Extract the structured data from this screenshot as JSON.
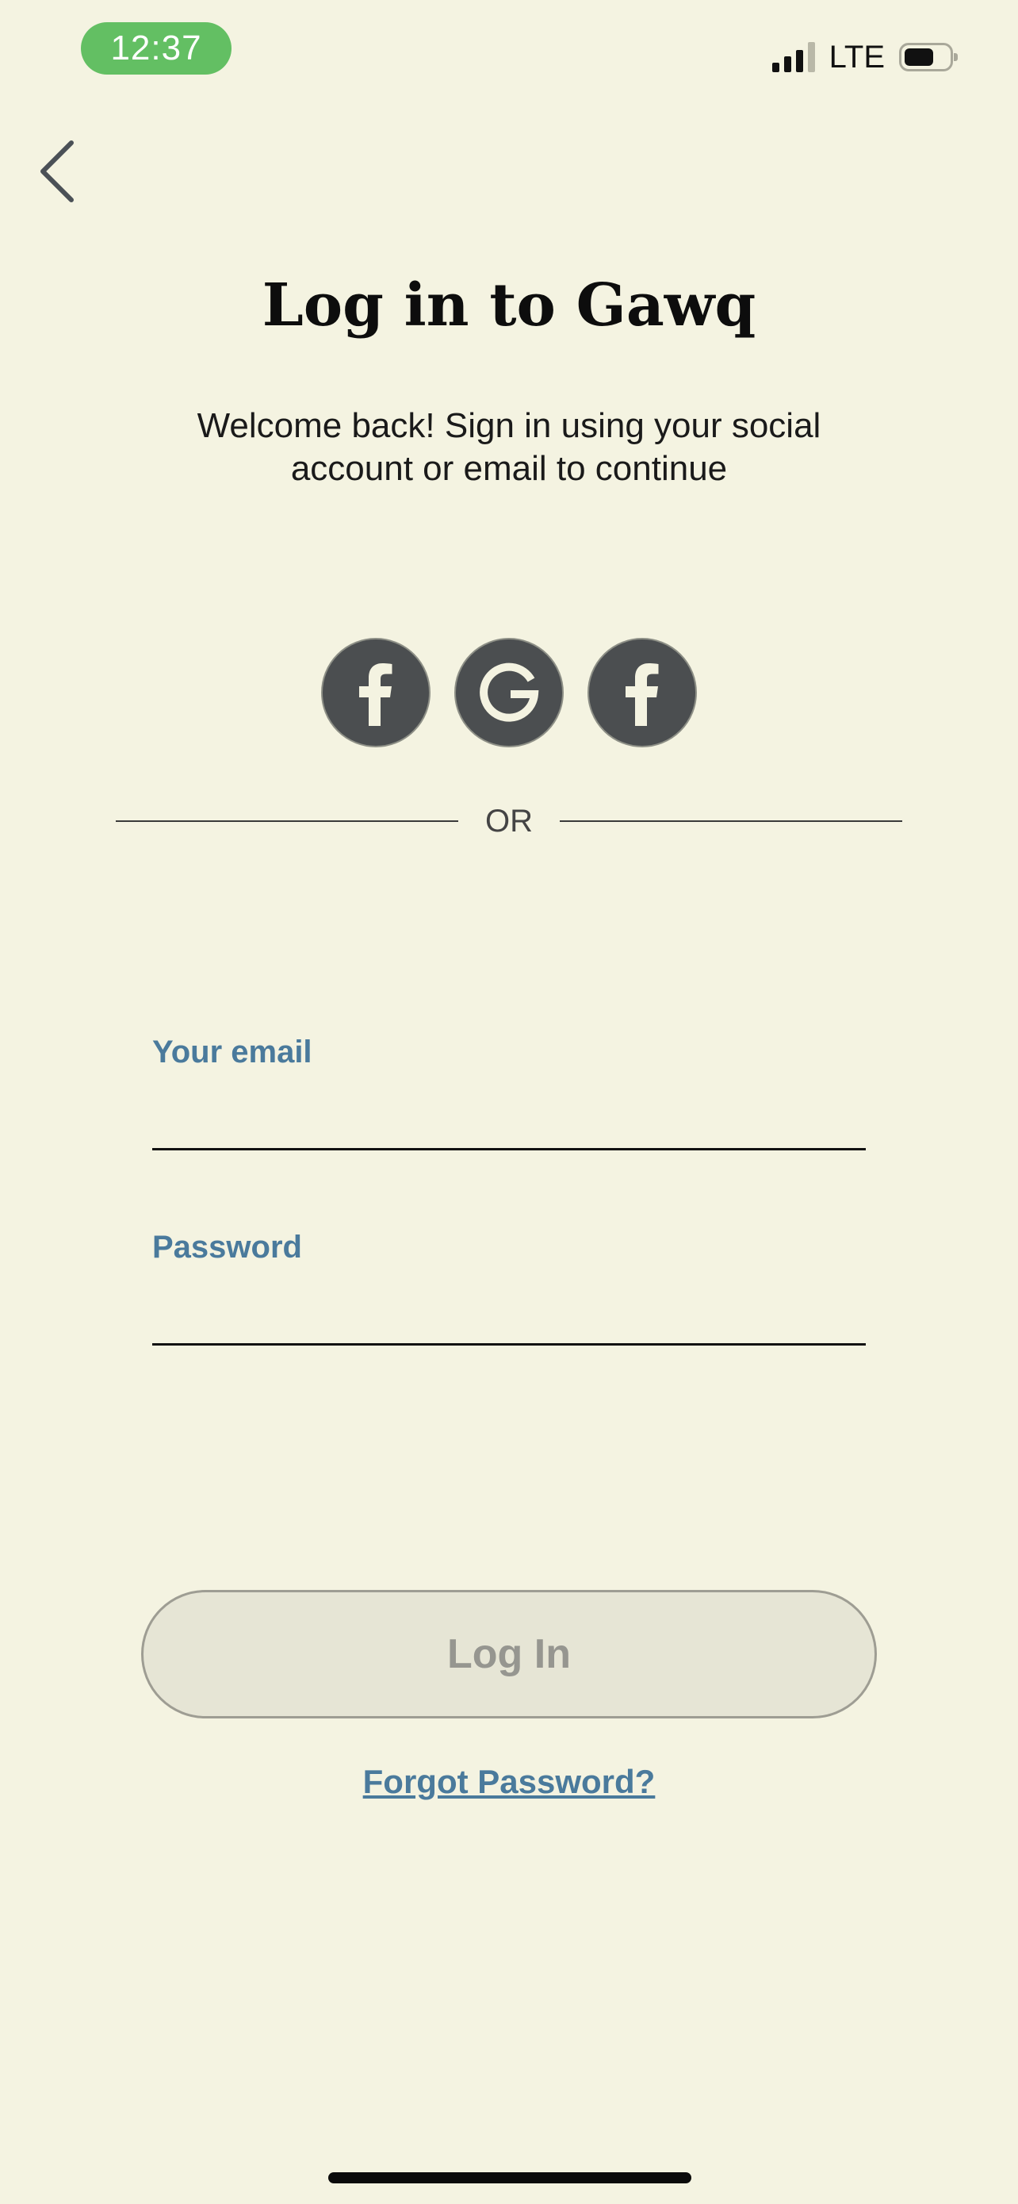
{
  "status_bar": {
    "time": "12:37",
    "network": "LTE",
    "icons": [
      "signal-icon",
      "battery-icon"
    ]
  },
  "header": {
    "back_icon": "chevron-left-icon",
    "title": "Log in to Gawq",
    "subtitle": "Welcome back! Sign in using your social account or email to continue"
  },
  "social": {
    "buttons": [
      {
        "icon": "facebook-icon"
      },
      {
        "icon": "google-icon"
      },
      {
        "icon": "facebook-icon"
      }
    ]
  },
  "divider": {
    "label": "OR"
  },
  "form": {
    "email_label": "Your email",
    "email_value": "",
    "password_label": "Password",
    "password_value": "",
    "submit_label": "Log In",
    "forgot_label": "Forgot Password?"
  },
  "colors": {
    "background": "#f4f3e1",
    "accent": "#4a7a9c",
    "time_pill": "#63bf63",
    "social_button": "#4b4e50",
    "button_disabled_bg": "#e6e5d5",
    "button_disabled_text": "#969690"
  }
}
